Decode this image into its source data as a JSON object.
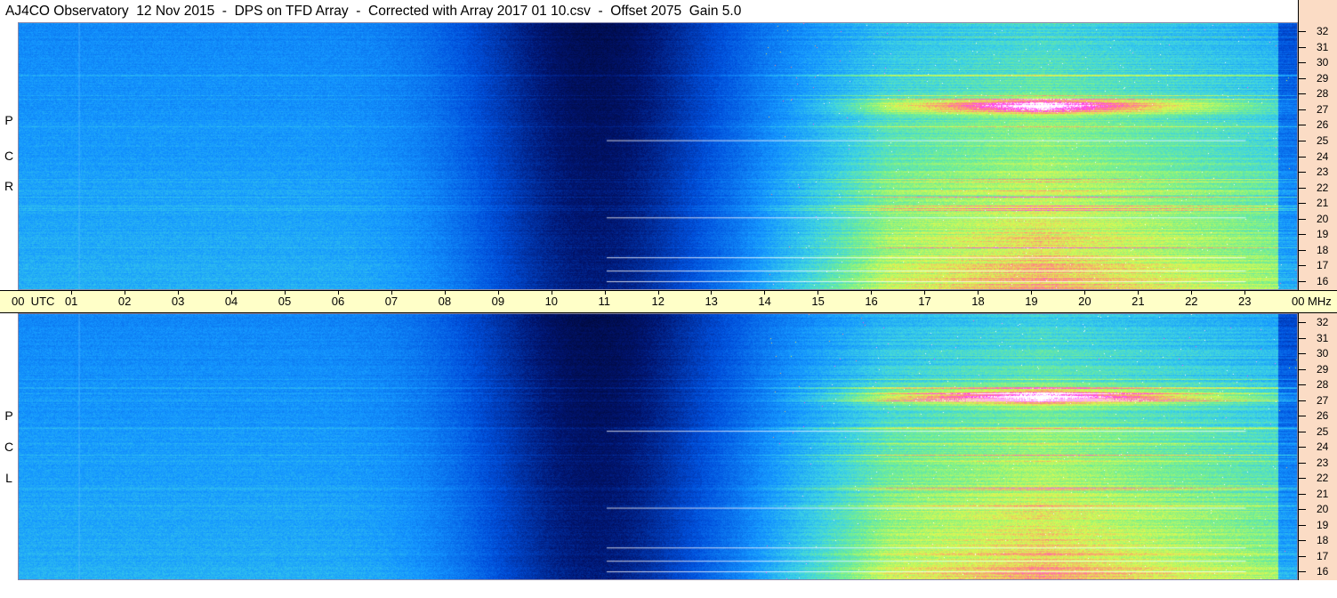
{
  "title": "AJ4CO Observatory  12 Nov 2015  -  DPS on TFD Array  -  Corrected with Array 2017 01 10.csv  -  Offset 2075  Gain 5.0",
  "panels": [
    {
      "id": "rcp",
      "label_letters": [
        "R",
        "C",
        "P"
      ]
    },
    {
      "id": "lcp",
      "label_letters": [
        "L",
        "C",
        "P"
      ]
    }
  ],
  "frequency_axis": {
    "unit": "MHz",
    "ticks": [
      "32",
      "31",
      "30",
      "29",
      "28",
      "27",
      "26",
      "25",
      "24",
      "23",
      "22",
      "21",
      "20",
      "19",
      "18",
      "17",
      "16"
    ]
  },
  "time_axis": {
    "start_label": "00  UTC",
    "ticks": [
      "01",
      "02",
      "03",
      "04",
      "05",
      "06",
      "07",
      "08",
      "09",
      "10",
      "11",
      "12",
      "13",
      "14",
      "15",
      "16",
      "17",
      "18",
      "19",
      "20",
      "21",
      "22",
      "23"
    ],
    "end_label": "00"
  },
  "colors": {
    "spectrogram_low": "#000033",
    "spectrogram_mid": "#0060ff",
    "spectrogram_high": "#80ff80",
    "spectrogram_peak": "#ff40ff",
    "freq_axis_bg": "#fbdcc5",
    "time_axis_bg": "#ffffc8"
  }
}
